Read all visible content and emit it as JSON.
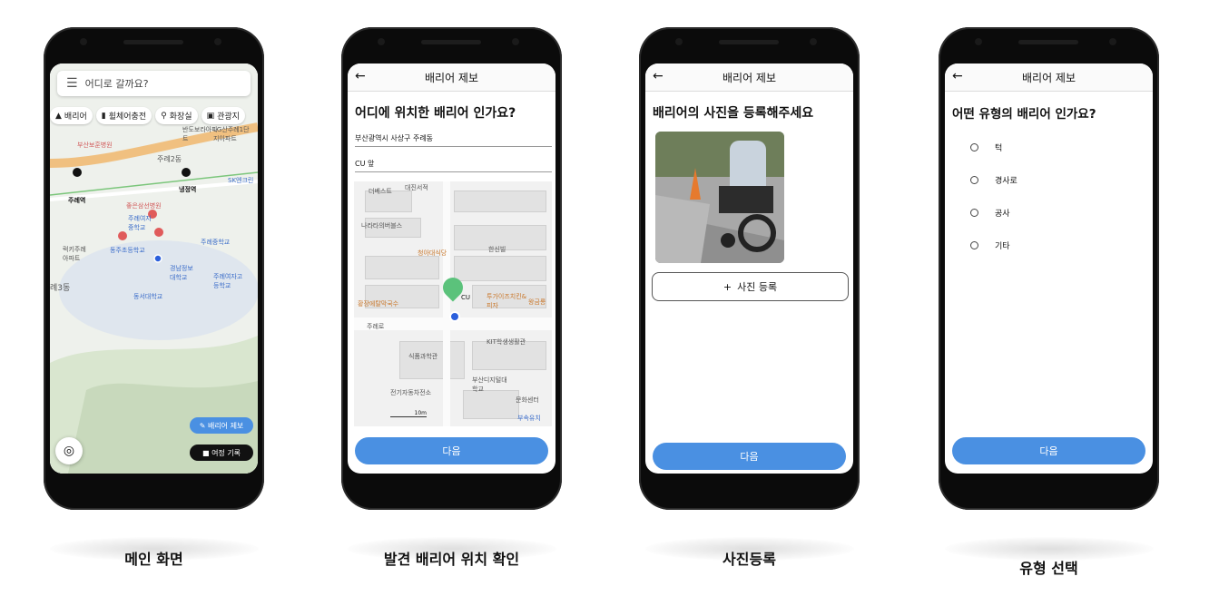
{
  "screens": {
    "main": {
      "caption": "메인 화면",
      "search_placeholder": "어디로 갈까요?",
      "chips": [
        "배리어",
        "휠체어충전",
        "화장실",
        "관광지"
      ],
      "map_labels": [
        "부산보훈병원",
        "반도보라아파트",
        "LG산주례1단지아파트",
        "주례2동",
        "주례역",
        "냉정역",
        "SK엔크린",
        "좋은삼선병원",
        "주례여자중학교",
        "동주초등학교",
        "주례중학교",
        "럭키주례아파트",
        "경남정보대학교",
        "주례여자고등학교",
        "동서대학교",
        "례3동"
      ],
      "report_button": "배리어 제보",
      "record_button": "여정 기록"
    },
    "location": {
      "caption": "발견 배리어 위치 확인",
      "title": "배리어 제보",
      "heading": "어디에 위치한 배리어 인가요?",
      "address": "부산광역시 사상구 주례동",
      "detail": "CU 앞",
      "map_labels": [
        "더베스트",
        "대진서적",
        "나라타의버블스",
        "청아대식당",
        "한신빌",
        "황장에탈막국수",
        "투가이즈치킨&피자",
        "왕금룡",
        "주례로",
        "KIT학생생활관",
        "식품과학관",
        "전기자동차전소",
        "부산디지털대학교",
        "문화센터",
        "부속유치",
        "CU"
      ],
      "scale": "10m",
      "next": "다음"
    },
    "photo": {
      "caption": "사진등록",
      "title": "배리어 제보",
      "heading": "배리어의 사진을 등록해주세요",
      "add_photo": "사진 등록",
      "next": "다음"
    },
    "type": {
      "caption": "유형 선택",
      "title": "배리어 제보",
      "heading": "어떤 유형의 배리어 인가요?",
      "options": [
        "턱",
        "경사로",
        "공사",
        "기타"
      ],
      "next": "다음"
    }
  },
  "colors": {
    "accent": "#4a90e2",
    "map_pin": "#5bc27b",
    "dark": "#111111"
  }
}
